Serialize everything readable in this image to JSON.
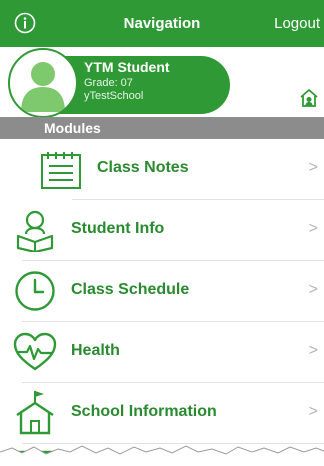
{
  "navbar": {
    "title": "Navigation",
    "logout_label": "Logout",
    "info_icon": "info-icon",
    "background": "#2f9a35"
  },
  "profile": {
    "name": "YTM Student",
    "grade": "Grade: 07",
    "school": "yTestSchool",
    "avatar_icon": "user-avatar-icon",
    "switch_icon": "home-switch-icon"
  },
  "modules": {
    "header": "Modules",
    "items": [
      {
        "label": "Class Notes",
        "icon": "notepad-icon"
      },
      {
        "label": "Student Info",
        "icon": "student-reading-icon"
      },
      {
        "label": "Class Schedule",
        "icon": "clock-icon"
      },
      {
        "label": "Health",
        "icon": "heart-pulse-icon"
      },
      {
        "label": "School Information",
        "icon": "school-house-icon"
      }
    ],
    "chevron": ">"
  },
  "colors": {
    "accent_green": "#2f9a35",
    "label_green": "#2a8a2f",
    "section_gray": "#8c8c8c",
    "chevron_gray": "#b5b5b5"
  }
}
